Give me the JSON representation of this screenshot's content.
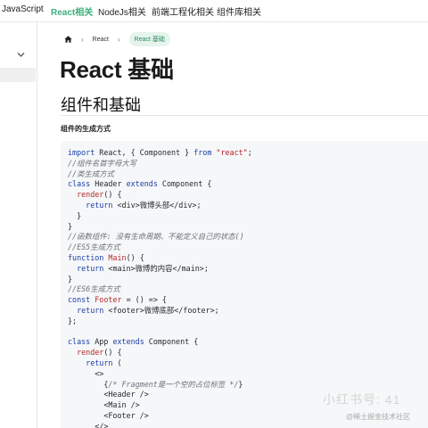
{
  "nav": {
    "items": [
      {
        "label": "JavaScript",
        "active": false
      },
      {
        "label": "React相关",
        "active": true
      },
      {
        "label": "NodeJs相关",
        "active": false
      },
      {
        "label": "前端工程化相关",
        "active": false
      },
      {
        "label": "组件库相关",
        "active": false
      }
    ]
  },
  "breadcrumb": {
    "home_icon": "home-icon",
    "items": [
      "React",
      "React 基础"
    ]
  },
  "page": {
    "title": "React 基础",
    "section_heading": "组件和基础",
    "paragraph": "组件的生成方式"
  },
  "code_lines": [
    [
      [
        "kw",
        "import"
      ],
      [
        "pl",
        " React, { Component } "
      ],
      [
        "kw",
        "from"
      ],
      [
        "pl",
        " "
      ],
      [
        "str",
        "\"react\""
      ],
      [
        "pl",
        ";"
      ]
    ],
    [
      [
        "cm",
        "//组件名首字母大写"
      ]
    ],
    [
      [
        "cm",
        "//类生成方式"
      ]
    ],
    [
      [
        "kw",
        "class"
      ],
      [
        "pl",
        " Header "
      ],
      [
        "kw",
        "extends"
      ],
      [
        "pl",
        " Component {"
      ]
    ],
    [
      [
        "pl",
        "  "
      ],
      [
        "fn",
        "render"
      ],
      [
        "pl",
        "() {"
      ]
    ],
    [
      [
        "pl",
        "    "
      ],
      [
        "kw",
        "return"
      ],
      [
        "pl",
        " <div>微博头部</div>;"
      ]
    ],
    [
      [
        "pl",
        "  }"
      ]
    ],
    [
      [
        "pl",
        "}"
      ]
    ],
    [
      [
        "cm",
        "//函数组件: 没有生命周期、不能定义自己的状态()"
      ]
    ],
    [
      [
        "cm",
        "//ES5生成方式"
      ]
    ],
    [
      [
        "kw",
        "function"
      ],
      [
        "pl",
        " "
      ],
      [
        "fn",
        "Main"
      ],
      [
        "pl",
        "() {"
      ]
    ],
    [
      [
        "pl",
        "  "
      ],
      [
        "kw",
        "return"
      ],
      [
        "pl",
        " <main>微博的内容</main>;"
      ]
    ],
    [
      [
        "pl",
        "}"
      ]
    ],
    [
      [
        "cm",
        "//ES6生成方式"
      ]
    ],
    [
      [
        "kw",
        "const"
      ],
      [
        "pl",
        " "
      ],
      [
        "fn",
        "Footer"
      ],
      [
        "pl",
        " = () => {"
      ]
    ],
    [
      [
        "pl",
        "  "
      ],
      [
        "kw",
        "return"
      ],
      [
        "pl",
        " <footer>微博底部</footer>;"
      ]
    ],
    [
      [
        "pl",
        "};"
      ]
    ],
    [
      [
        "pl",
        ""
      ]
    ],
    [
      [
        "kw",
        "class"
      ],
      [
        "pl",
        " App "
      ],
      [
        "kw",
        "extends"
      ],
      [
        "pl",
        " Component {"
      ]
    ],
    [
      [
        "pl",
        "  "
      ],
      [
        "fn",
        "render"
      ],
      [
        "pl",
        "() {"
      ]
    ],
    [
      [
        "pl",
        "    "
      ],
      [
        "kw",
        "return"
      ],
      [
        "pl",
        " ("
      ]
    ],
    [
      [
        "pl",
        "      <>"
      ]
    ],
    [
      [
        "pl",
        "        {"
      ],
      [
        "cm",
        "/* Fragment是一个空的占位标签 */"
      ],
      [
        "pl",
        "}"
      ]
    ],
    [
      [
        "pl",
        "        <Header />"
      ]
    ],
    [
      [
        "pl",
        "        <Main />"
      ]
    ],
    [
      [
        "pl",
        "        <Footer />"
      ]
    ],
    [
      [
        "pl",
        "      </>"
      ]
    ]
  ],
  "watermark": {
    "line1": "小红书号: 41",
    "line2": "@稀土掘金技术社区"
  },
  "colors": {
    "accent": "#3eaf7c",
    "code_bg": "#f6f7f8",
    "keyword": "#1a3fa8",
    "string": "#b31d28",
    "comment": "#6a737d"
  }
}
